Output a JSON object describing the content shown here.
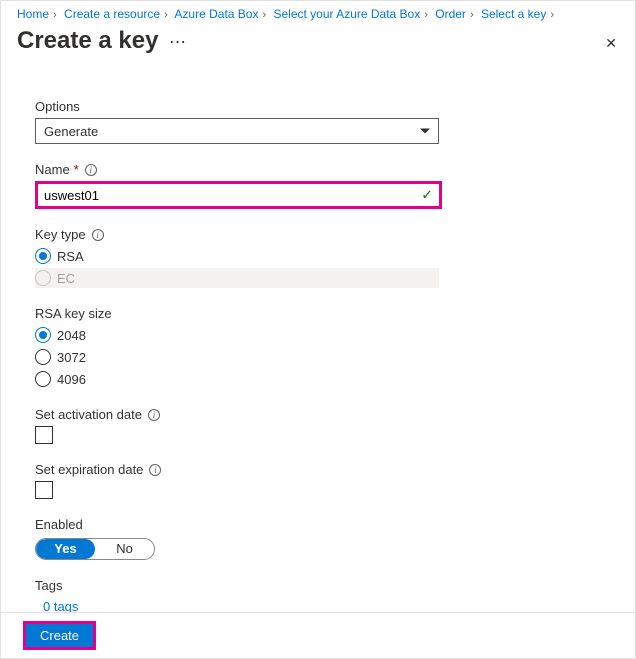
{
  "breadcrumb": [
    "Home",
    "Create a resource",
    "Azure Data Box",
    "Select your Azure Data Box",
    "Order",
    "Select a key"
  ],
  "title": "Create a key",
  "options": {
    "label": "Options",
    "value": "Generate"
  },
  "name": {
    "label": "Name",
    "value": "uswest01"
  },
  "keyType": {
    "label": "Key type",
    "options": [
      "RSA",
      "EC"
    ],
    "selected": "RSA"
  },
  "keySize": {
    "label": "RSA key size",
    "options": [
      "2048",
      "3072",
      "4096"
    ],
    "selected": "2048"
  },
  "activation": {
    "label": "Set activation date"
  },
  "expiration": {
    "label": "Set expiration date"
  },
  "enabled": {
    "label": "Enabled",
    "yes": "Yes",
    "no": "No"
  },
  "tags": {
    "label": "Tags",
    "link": "0 tags"
  },
  "createLabel": "Create"
}
